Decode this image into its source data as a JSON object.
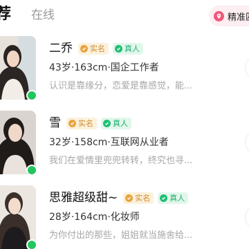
{
  "tabs": {
    "recommend_label": "荐",
    "online_label": "在线"
  },
  "filter": {
    "label": "精准匹",
    "icon": "location-pin-icon",
    "color": "#f0587a"
  },
  "badges": {
    "verified_label": "实名",
    "real_label": "真人"
  },
  "colors": {
    "online": "#22c55e",
    "verified": "#e9a33f",
    "real": "#1fbf74"
  },
  "profiles": [
    {
      "name": "二乔",
      "details": "43岁·163cm·国企工作者",
      "bio": "认识是靠缘分，恋爱是靠感觉，能..."
    },
    {
      "name": "雪",
      "details": "32岁·158cm·互联网从业者",
      "bio": "我们在爱情里兜兜转转，终究也寻..."
    },
    {
      "name": "思雅超级甜~",
      "details": "28岁·164cm·化妆师",
      "bio": "为你付出的那些，姐姐就当施舍给..."
    }
  ]
}
